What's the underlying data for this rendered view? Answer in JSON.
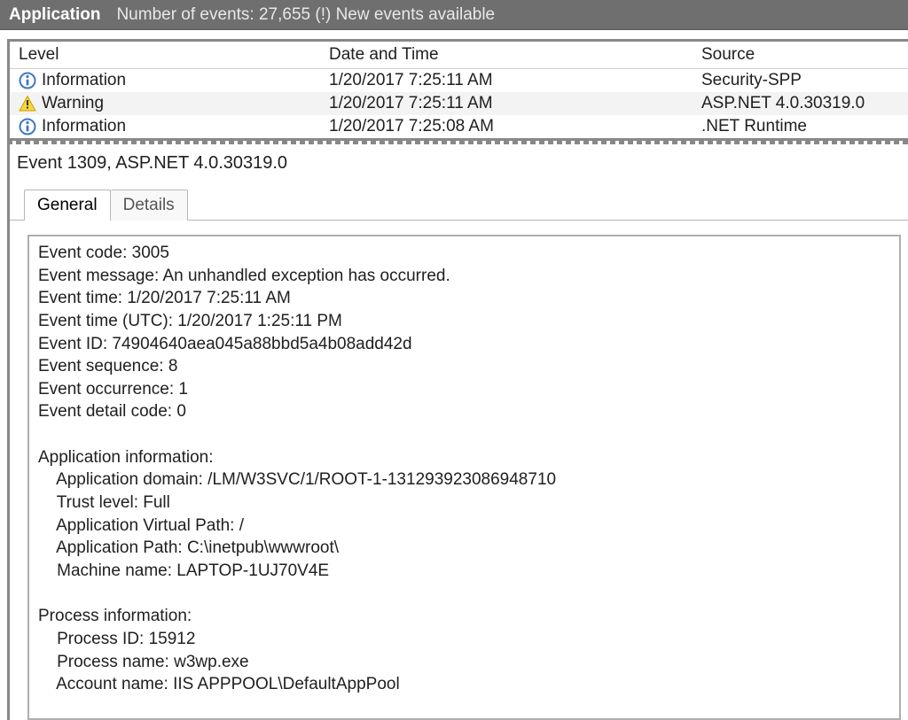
{
  "titlebar": {
    "title": "Application",
    "subtitle": "Number of events: 27,655 (!) New events available"
  },
  "grid": {
    "headers": {
      "level": "Level",
      "date": "Date and Time",
      "source": "Source"
    },
    "rows": [
      {
        "icon": "info",
        "level": "Information",
        "date": "1/20/2017 7:25:11 AM",
        "source": "Security-SPP"
      },
      {
        "icon": "warning",
        "level": "Warning",
        "date": "1/20/2017 7:25:11 AM",
        "source": "ASP.NET 4.0.30319.0"
      },
      {
        "icon": "info",
        "level": "Information",
        "date": "1/20/2017 7:25:08 AM",
        "source": ".NET Runtime"
      }
    ]
  },
  "details": {
    "heading": "Event 1309, ASP.NET 4.0.30319.0",
    "tabs": {
      "general": "General",
      "details": "Details"
    },
    "body": "Event code: 3005\nEvent message: An unhandled exception has occurred.\nEvent time: 1/20/2017 7:25:11 AM\nEvent time (UTC): 1/20/2017 1:25:11 PM\nEvent ID: 74904640aea045a88bbd5a4b08add42d\nEvent sequence: 8\nEvent occurrence: 1\nEvent detail code: 0\n\nApplication information:\n    Application domain: /LM/W3SVC/1/ROOT-1-131293923086948710\n    Trust level: Full\n    Application Virtual Path: /\n    Application Path: C:\\inetpub\\wwwroot\\\n    Machine name: LAPTOP-1UJ70V4E\n\nProcess information:\n    Process ID: 15912\n    Process name: w3wp.exe\n    Account name: IIS APPPOOL\\DefaultAppPool"
  }
}
